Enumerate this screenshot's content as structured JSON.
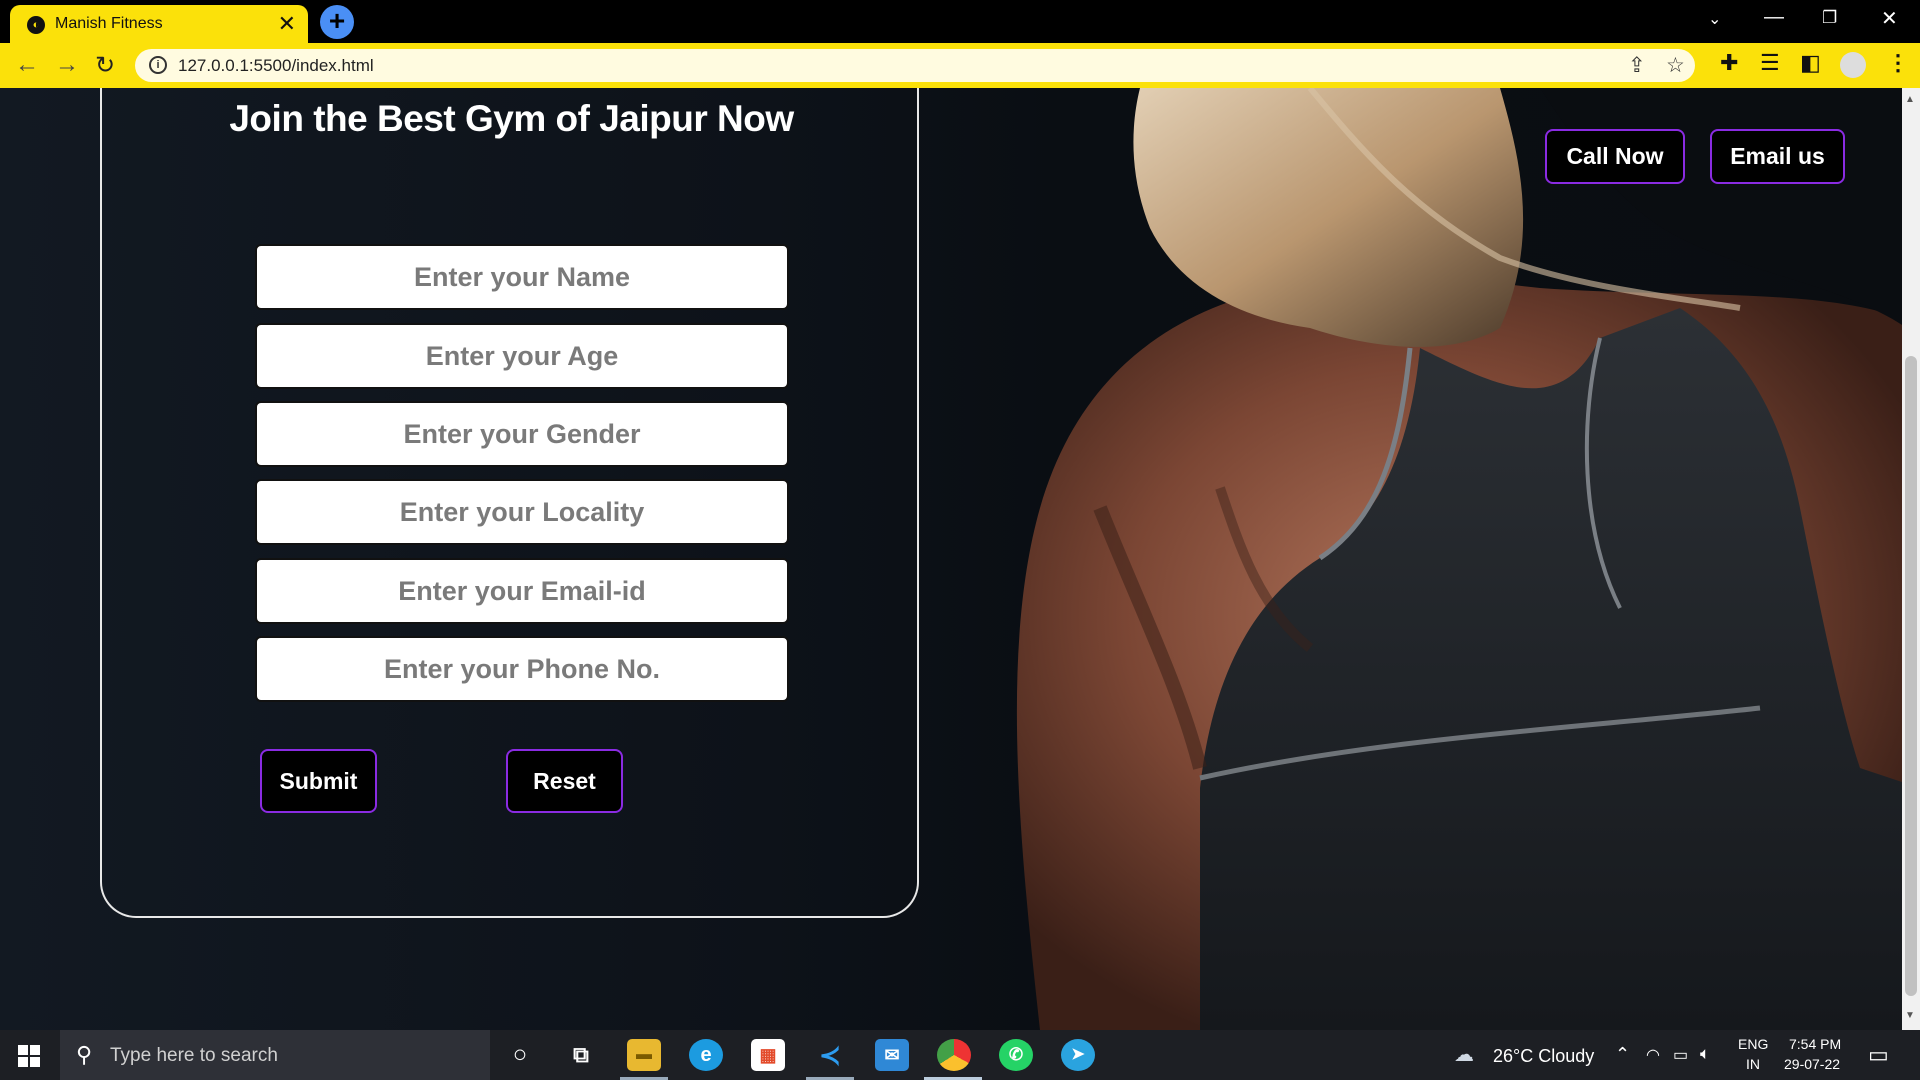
{
  "browser": {
    "tab_title": "Manish Fitness",
    "tab_close": "✕",
    "new_tab": "+",
    "url": "127.0.0.1:5500/index.html"
  },
  "page": {
    "heading": "Join the Best Gym of Jaipur Now",
    "fields": [
      {
        "placeholder": "Enter your Name"
      },
      {
        "placeholder": "Enter your Age"
      },
      {
        "placeholder": "Enter your Gender"
      },
      {
        "placeholder": "Enter your Locality"
      },
      {
        "placeholder": "Enter your Email-id"
      },
      {
        "placeholder": "Enter your Phone No."
      }
    ],
    "submit_label": "Submit",
    "reset_label": "Reset",
    "call_label": "Call Now",
    "email_label": "Email us",
    "accent_color": "#8a2be2"
  },
  "taskbar": {
    "search_placeholder": "Type here to search",
    "weather": "26°C  Cloudy",
    "lang_top": "ENG",
    "lang_bottom": "IN",
    "time": "7:54 PM",
    "date": "29-07-22"
  }
}
